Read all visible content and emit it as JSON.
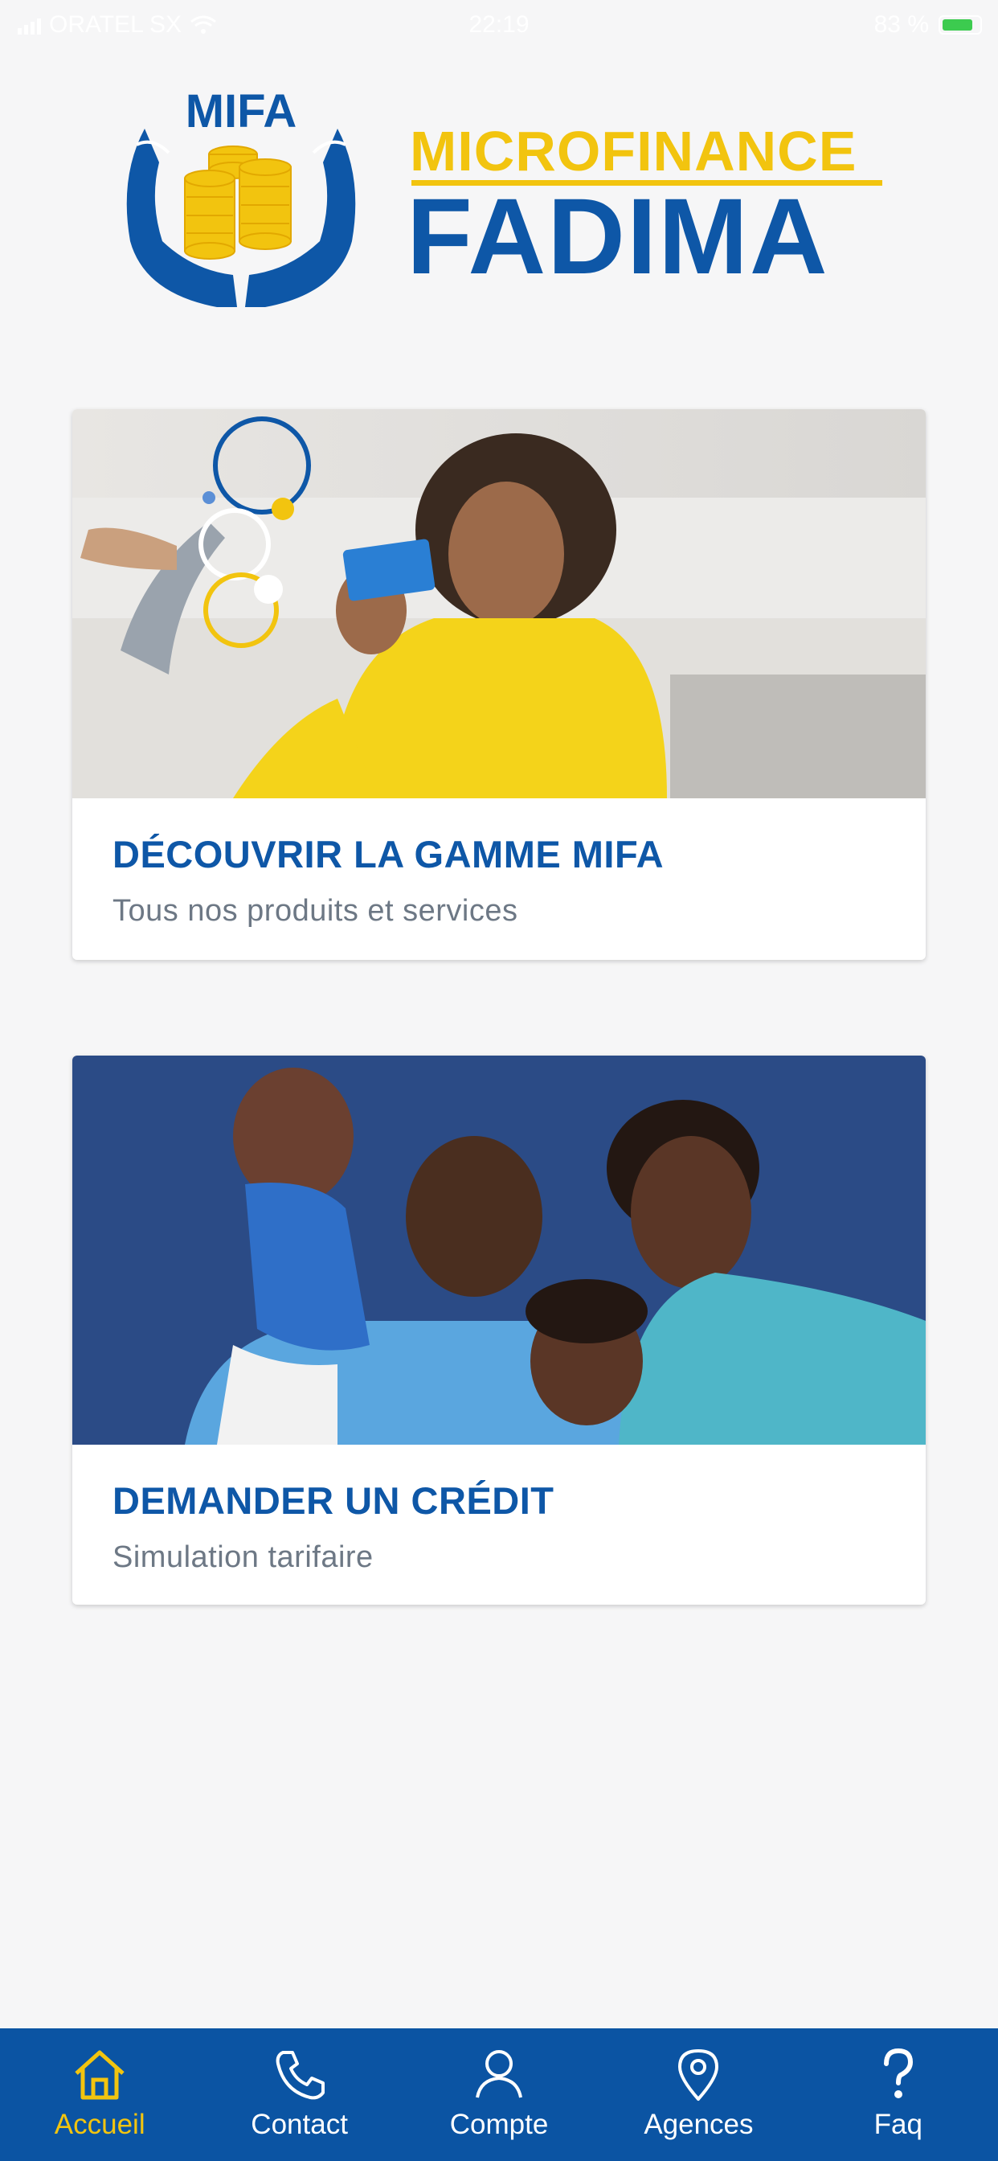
{
  "status_bar": {
    "carrier": "ORATEL SX",
    "time": "22:19",
    "battery": "83 %",
    "battery_level": 0.83
  },
  "logo": {
    "badge_text": "MIFA",
    "line1": "MICROFINANCE",
    "line2": "FADIMA"
  },
  "cards": [
    {
      "title": "DÉCOUVRIR LA GAMME MIFA",
      "subtitle": "Tous nos produits et services"
    },
    {
      "title": "DEMANDER UN CRÉDIT",
      "subtitle": "Simulation tarifaire"
    }
  ],
  "tabs": [
    {
      "label": "Accueil",
      "icon": "home-icon",
      "active": true
    },
    {
      "label": "Contact",
      "icon": "phone-icon",
      "active": false
    },
    {
      "label": "Compte",
      "icon": "user-icon",
      "active": false
    },
    {
      "label": "Agences",
      "icon": "map-pin-icon",
      "active": false
    },
    {
      "label": "Faq",
      "icon": "question-icon",
      "active": false
    }
  ],
  "colors": {
    "brand_blue": "#0e57a7",
    "brand_yellow": "#f2c40f",
    "tab_bar": "#0b54a3",
    "background": "#f6f6f7"
  }
}
